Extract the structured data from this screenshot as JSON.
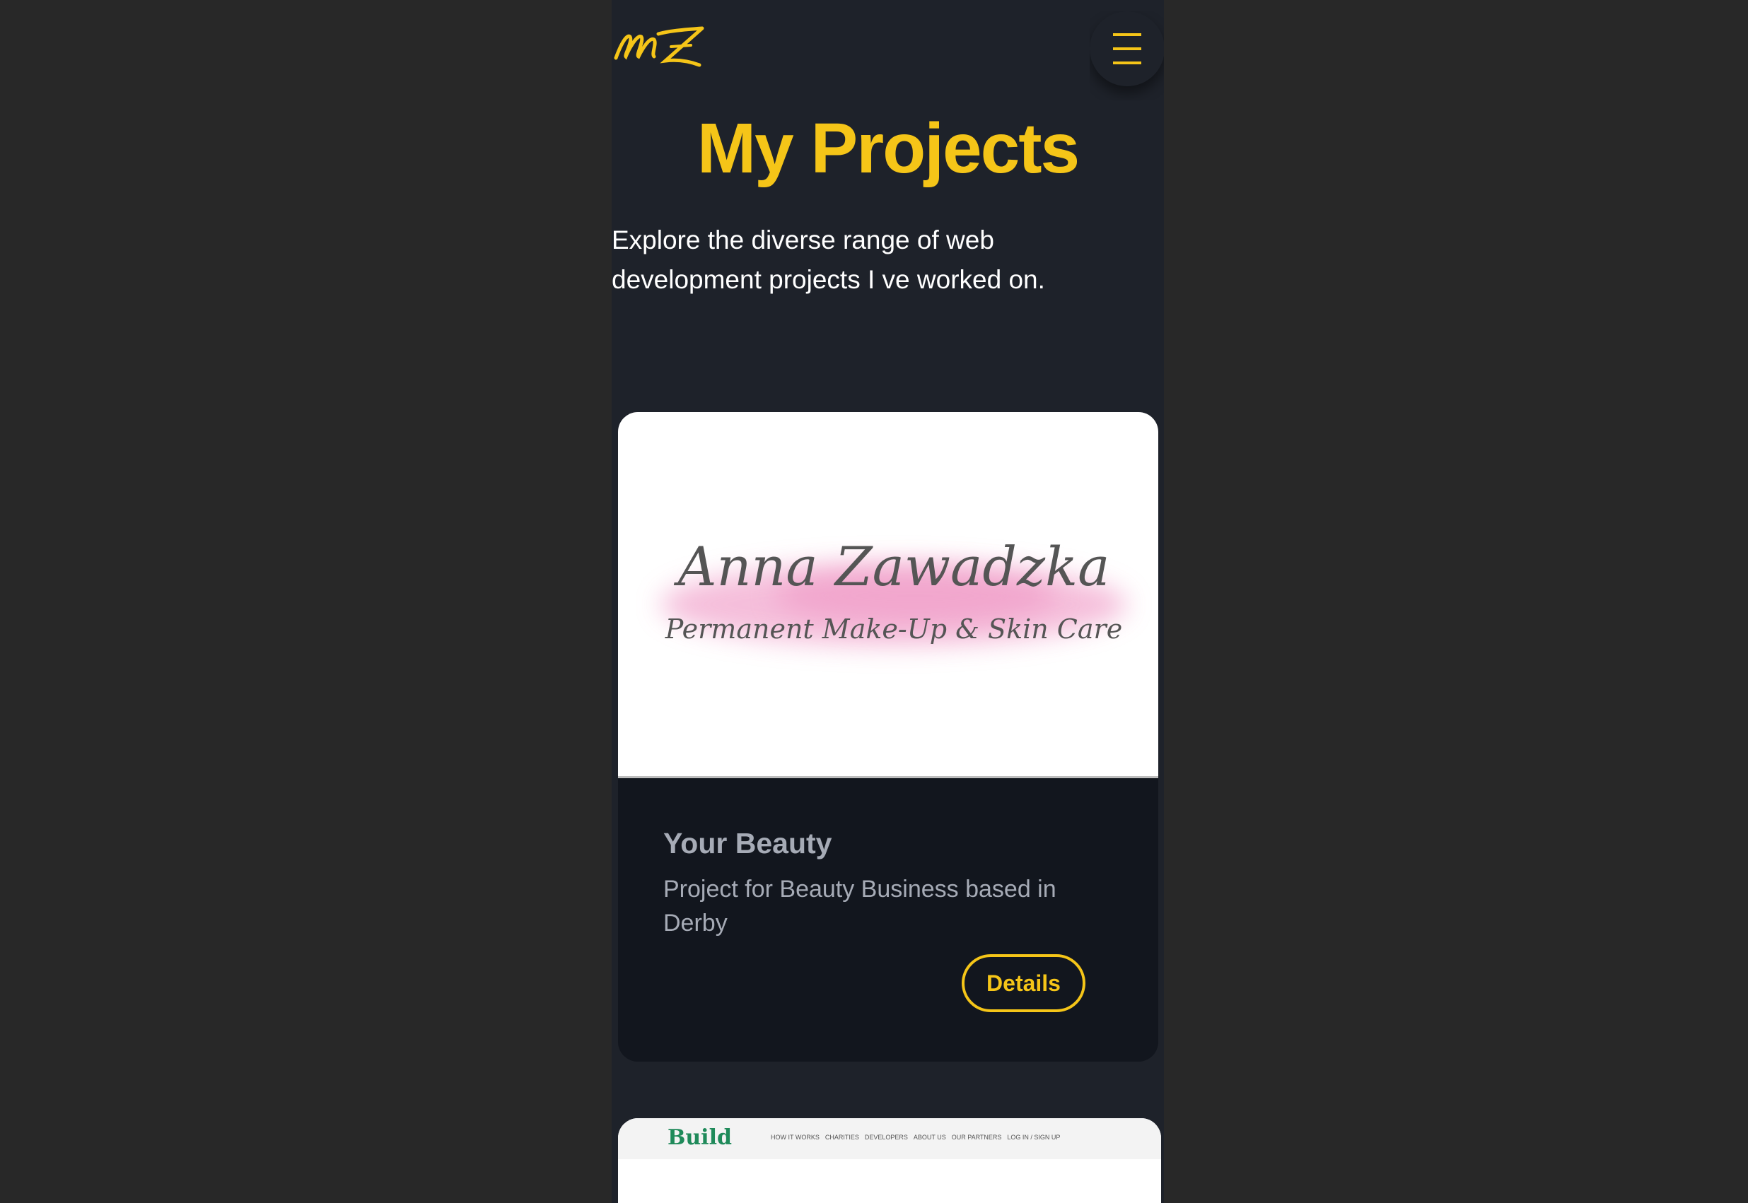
{
  "header": {
    "logo_text": "MZ",
    "menu_icon": "hamburger-menu-icon"
  },
  "hero": {
    "title": "My Projects",
    "intro": "Explore the diverse range of web development projects I ve worked on."
  },
  "projects": [
    {
      "image_title": "Anna Zawadzka",
      "image_subtitle": "Permanent Make-Up & Skin Care",
      "title": "Your Beauty",
      "description": "Project for Beauty Business based in Derby",
      "button_label": "Details"
    },
    {
      "image_logo": "Build",
      "image_nav": [
        "HOW IT WORKS",
        "CHARITIES",
        "DEVELOPERS",
        "ABOUT US",
        "OUR PARTNERS",
        "LOG IN / SIGN UP"
      ]
    }
  ],
  "colors": {
    "accent": "#f5c518",
    "page_background": "#1e222a",
    "outer_background": "#282828",
    "card_background": "#12161e",
    "muted_text": "#a6abb6"
  }
}
